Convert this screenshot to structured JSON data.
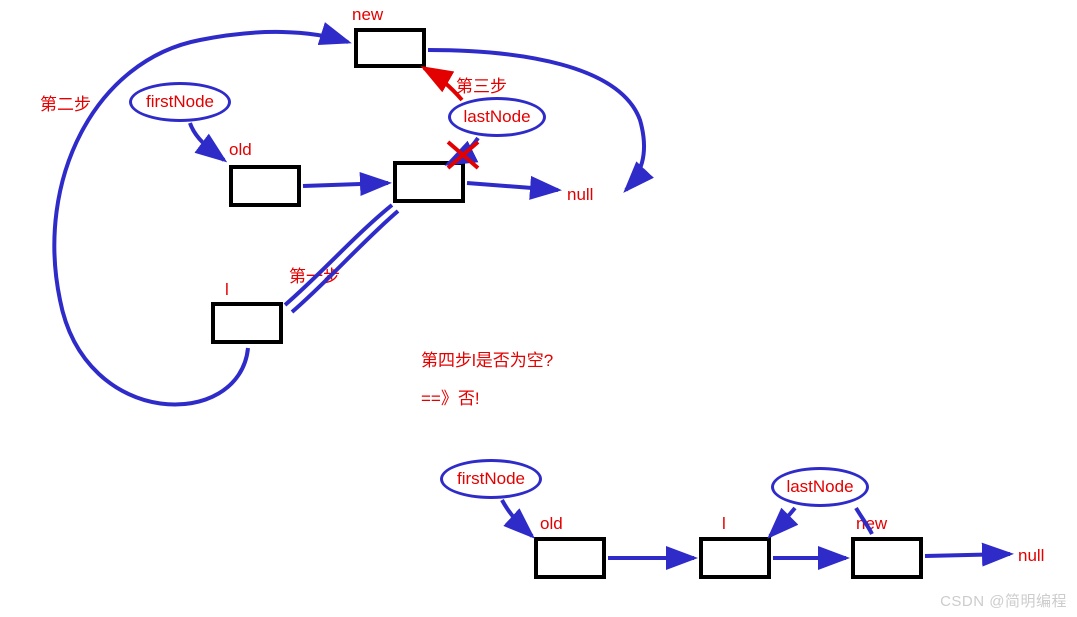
{
  "labels": {
    "new1": "new",
    "step3": "第三步",
    "step2": "第二步",
    "firstNode1": "firstNode",
    "lastNode1": "lastNode",
    "old1": "old",
    "null1": "null",
    "step1": "第一步",
    "l1": "l",
    "step4_q": "第四步l是否为空?",
    "step4_a": "==》否!",
    "firstNode2": "firstNode",
    "old2": "old",
    "l2": "l",
    "lastNode2": "lastNode",
    "new2": "new",
    "null2": "null",
    "watermark": "CSDN @简明编程"
  }
}
